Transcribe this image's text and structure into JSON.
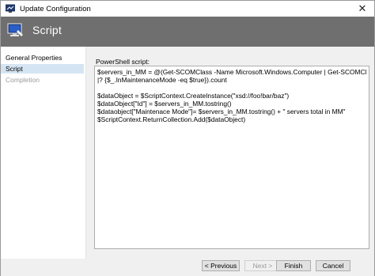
{
  "window": {
    "title": "Update Configuration",
    "close_glyph": "✕"
  },
  "banner": {
    "title": "Script",
    "icon": "monitor-wizard-icon",
    "background": "#6f6f6f"
  },
  "sidebar": {
    "items": [
      {
        "label": "General Properties",
        "state": "normal"
      },
      {
        "label": "Script",
        "state": "selected"
      },
      {
        "label": "Completion",
        "state": "disabled"
      }
    ],
    "selected_color": "#d5e4f2"
  },
  "main": {
    "field_label": "PowerShell script:",
    "script_lines": [
      "$servers_in_MM = @(Get-SCOMClass -Name Microsoft.Windows.Computer | Get-SCOMClassInstance",
      "|? {$_.InMaintenanceMode -eq $true}).count",
      "",
      "$dataObject = $ScriptContext.CreateInstance(\"xsd://foo!bar/baz\")",
      "$dataObject[\"Id\"] = $servers_in_MM.tostring()",
      "$dataobject[\"Maintenace Mode\"]= $servers_in_MM.tostring() + \" servers total in MM\"",
      "$ScriptContext.ReturnCollection.Add($dataObject)"
    ]
  },
  "footer": {
    "previous_label": "< Previous",
    "next_label": "Next >",
    "finish_label": "Finish",
    "cancel_label": "Cancel"
  }
}
